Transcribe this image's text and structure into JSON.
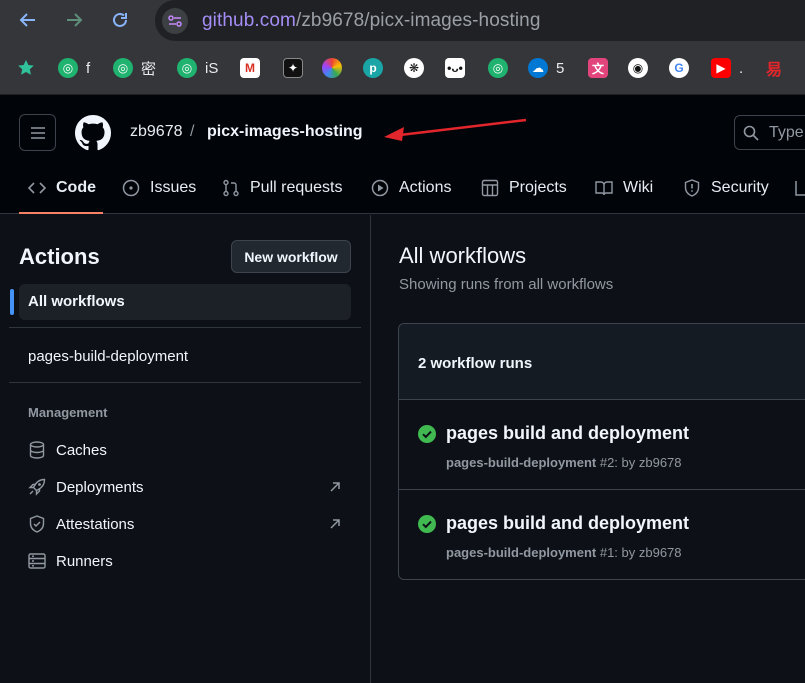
{
  "browser": {
    "url_host": "github.com",
    "url_path": "/zb9678/picx-images-hosting",
    "bookmarks": [
      {
        "icon": "globe-icon",
        "label": "f"
      },
      {
        "icon": "globe-icon",
        "label": "密"
      },
      {
        "icon": "globe-icon",
        "label": "iS"
      },
      {
        "icon": "gmail-icon",
        "label": ""
      },
      {
        "icon": "app-icon",
        "label": ""
      },
      {
        "icon": "photos-icon",
        "label": ""
      },
      {
        "icon": "p-icon",
        "label": ""
      },
      {
        "icon": "openai-icon",
        "label": ""
      },
      {
        "icon": "app-icon",
        "label": ""
      },
      {
        "icon": "globe-icon",
        "label": ""
      },
      {
        "icon": "onedrive-icon",
        "label": "5"
      },
      {
        "icon": "app-icon",
        "label": ""
      },
      {
        "icon": "github-icon",
        "label": ""
      },
      {
        "icon": "google-icon",
        "label": ""
      },
      {
        "icon": "youtube-icon",
        "label": "."
      },
      {
        "icon": "app-icon",
        "label": ""
      }
    ]
  },
  "header": {
    "owner": "zb9678",
    "separator": "/",
    "repo": "picx-images-hosting",
    "search_placeholder": "Type"
  },
  "tabs": [
    {
      "icon": "code-icon",
      "label": "Code",
      "active": true
    },
    {
      "icon": "issues-icon",
      "label": "Issues"
    },
    {
      "icon": "pull-request-icon",
      "label": "Pull requests"
    },
    {
      "icon": "play-icon",
      "label": "Actions"
    },
    {
      "icon": "projects-icon",
      "label": "Projects"
    },
    {
      "icon": "book-icon",
      "label": "Wiki"
    },
    {
      "icon": "shield-icon",
      "label": "Security"
    }
  ],
  "sidebar": {
    "title": "Actions",
    "new_workflow": "New workflow",
    "all_workflows": "All workflows",
    "workflow_item": "pages-build-deployment",
    "management_heading": "Management",
    "management_items": [
      "Caches",
      "Deployments",
      "Attestations",
      "Runners"
    ]
  },
  "main": {
    "title": "All workflows",
    "subtitle": "Showing runs from all workflows",
    "runs_count": "2 workflow runs",
    "runs": [
      {
        "title": "pages build and deployment",
        "workflow": "pages-build-deployment",
        "meta": " #2: by zb9678",
        "status": "success"
      },
      {
        "title": "pages build and deployment",
        "workflow": "pages-build-deployment",
        "meta": " #1: by zb9678",
        "status": "success"
      }
    ]
  },
  "colors": {
    "background": "#0d1117",
    "accent_tab": "#f78166",
    "selected_bar": "#4493f8",
    "success": "#3fb950",
    "annotation_arrow": "#e3262b"
  }
}
